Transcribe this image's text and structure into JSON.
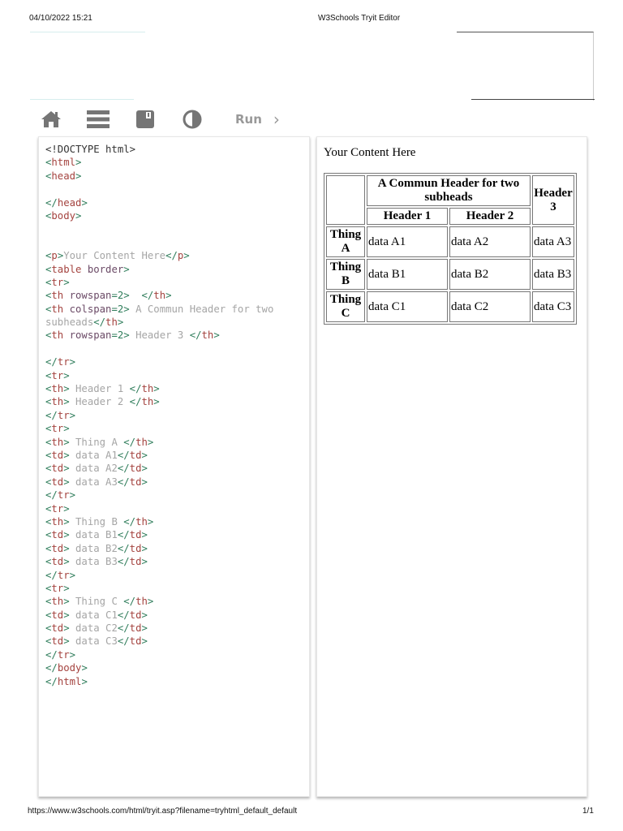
{
  "print_header": {
    "datetime": "04/10/2022 15:21",
    "title": "W3Schools Tryit Editor"
  },
  "toolbar": {
    "home_icon": "home-icon",
    "menu_icon": "menu-icon",
    "save_icon": "save-icon",
    "theme_icon": "contrast-icon",
    "run_label": "Run",
    "run_arrow": "›"
  },
  "colors": {
    "bracket": "#2f7d5b",
    "tag": "#a4433f",
    "attr": "#6b4a66",
    "text": "#a5a5a5"
  },
  "code_lines": [
    [
      [
        "d",
        "<!DOCTYPE html>"
      ]
    ],
    [
      [
        "b",
        "<"
      ],
      [
        "t",
        "html"
      ],
      [
        "b",
        ">"
      ]
    ],
    [
      [
        "b",
        "<"
      ],
      [
        "t",
        "head"
      ],
      [
        "b",
        ">"
      ]
    ],
    [],
    [
      [
        "b",
        "</"
      ],
      [
        "t",
        "head"
      ],
      [
        "b",
        ">"
      ]
    ],
    [
      [
        "b",
        "<"
      ],
      [
        "t",
        "body"
      ],
      [
        "b",
        ">"
      ]
    ],
    [],
    [],
    [
      [
        "b",
        "<"
      ],
      [
        "t",
        "p"
      ],
      [
        "b",
        ">"
      ],
      [
        "x",
        "Your Content Here"
      ],
      [
        "b",
        "</"
      ],
      [
        "t",
        "p"
      ],
      [
        "b",
        ">"
      ]
    ],
    [
      [
        "b",
        "<"
      ],
      [
        "t",
        "table"
      ],
      [
        "a",
        " border"
      ],
      [
        "b",
        ">"
      ]
    ],
    [
      [
        "b",
        "<"
      ],
      [
        "t",
        "tr"
      ],
      [
        "b",
        ">"
      ]
    ],
    [
      [
        "b",
        "<"
      ],
      [
        "t",
        "th"
      ],
      [
        "a",
        " rowspan"
      ],
      [
        "v",
        "=2"
      ],
      [
        "b",
        ">"
      ],
      [
        "x",
        "  "
      ],
      [
        "b",
        "</"
      ],
      [
        "t",
        "th"
      ],
      [
        "b",
        ">"
      ]
    ],
    [
      [
        "b",
        "<"
      ],
      [
        "t",
        "th"
      ],
      [
        "a",
        " colspan"
      ],
      [
        "v",
        "=2"
      ],
      [
        "b",
        ">"
      ],
      [
        "x",
        " A Commun Header for two"
      ]
    ],
    [
      [
        "x",
        "subheads"
      ],
      [
        "b",
        "</"
      ],
      [
        "t",
        "th"
      ],
      [
        "b",
        ">"
      ]
    ],
    [
      [
        "b",
        "<"
      ],
      [
        "t",
        "th"
      ],
      [
        "a",
        " rowspan"
      ],
      [
        "v",
        "=2"
      ],
      [
        "b",
        ">"
      ],
      [
        "x",
        " Header 3 "
      ],
      [
        "b",
        "</"
      ],
      [
        "t",
        "th"
      ],
      [
        "b",
        ">"
      ]
    ],
    [],
    [
      [
        "b",
        "</"
      ],
      [
        "t",
        "tr"
      ],
      [
        "b",
        ">"
      ]
    ],
    [
      [
        "b",
        "<"
      ],
      [
        "t",
        "tr"
      ],
      [
        "b",
        ">"
      ]
    ],
    [
      [
        "b",
        "<"
      ],
      [
        "t",
        "th"
      ],
      [
        "b",
        ">"
      ],
      [
        "x",
        " Header 1 "
      ],
      [
        "b",
        "</"
      ],
      [
        "t",
        "th"
      ],
      [
        "b",
        ">"
      ]
    ],
    [
      [
        "b",
        "<"
      ],
      [
        "t",
        "th"
      ],
      [
        "b",
        ">"
      ],
      [
        "x",
        " Header 2 "
      ],
      [
        "b",
        "</"
      ],
      [
        "t",
        "th"
      ],
      [
        "b",
        ">"
      ]
    ],
    [
      [
        "b",
        "</"
      ],
      [
        "t",
        "tr"
      ],
      [
        "b",
        ">"
      ]
    ],
    [
      [
        "b",
        "<"
      ],
      [
        "t",
        "tr"
      ],
      [
        "b",
        ">"
      ]
    ],
    [
      [
        "b",
        "<"
      ],
      [
        "t",
        "th"
      ],
      [
        "b",
        ">"
      ],
      [
        "x",
        " Thing A "
      ],
      [
        "b",
        "</"
      ],
      [
        "t",
        "th"
      ],
      [
        "b",
        ">"
      ]
    ],
    [
      [
        "b",
        "<"
      ],
      [
        "t",
        "td"
      ],
      [
        "b",
        ">"
      ],
      [
        "x",
        " data A1"
      ],
      [
        "b",
        "</"
      ],
      [
        "t",
        "td"
      ],
      [
        "b",
        ">"
      ]
    ],
    [
      [
        "b",
        "<"
      ],
      [
        "t",
        "td"
      ],
      [
        "b",
        ">"
      ],
      [
        "x",
        " data A2"
      ],
      [
        "b",
        "</"
      ],
      [
        "t",
        "td"
      ],
      [
        "b",
        ">"
      ]
    ],
    [
      [
        "b",
        "<"
      ],
      [
        "t",
        "td"
      ],
      [
        "b",
        ">"
      ],
      [
        "x",
        " data A3"
      ],
      [
        "b",
        "</"
      ],
      [
        "t",
        "td"
      ],
      [
        "b",
        ">"
      ]
    ],
    [
      [
        "b",
        "</"
      ],
      [
        "t",
        "tr"
      ],
      [
        "b",
        ">"
      ]
    ],
    [
      [
        "b",
        "<"
      ],
      [
        "t",
        "tr"
      ],
      [
        "b",
        ">"
      ]
    ],
    [
      [
        "b",
        "<"
      ],
      [
        "t",
        "th"
      ],
      [
        "b",
        ">"
      ],
      [
        "x",
        " Thing B "
      ],
      [
        "b",
        "</"
      ],
      [
        "t",
        "th"
      ],
      [
        "b",
        ">"
      ]
    ],
    [
      [
        "b",
        "<"
      ],
      [
        "t",
        "td"
      ],
      [
        "b",
        ">"
      ],
      [
        "x",
        " data B1"
      ],
      [
        "b",
        "</"
      ],
      [
        "t",
        "td"
      ],
      [
        "b",
        ">"
      ]
    ],
    [
      [
        "b",
        "<"
      ],
      [
        "t",
        "td"
      ],
      [
        "b",
        ">"
      ],
      [
        "x",
        " data B2"
      ],
      [
        "b",
        "</"
      ],
      [
        "t",
        "td"
      ],
      [
        "b",
        ">"
      ]
    ],
    [
      [
        "b",
        "<"
      ],
      [
        "t",
        "td"
      ],
      [
        "b",
        ">"
      ],
      [
        "x",
        " data B3"
      ],
      [
        "b",
        "</"
      ],
      [
        "t",
        "td"
      ],
      [
        "b",
        ">"
      ]
    ],
    [
      [
        "b",
        "</"
      ],
      [
        "t",
        "tr"
      ],
      [
        "b",
        ">"
      ]
    ],
    [
      [
        "b",
        "<"
      ],
      [
        "t",
        "tr"
      ],
      [
        "b",
        ">"
      ]
    ],
    [
      [
        "b",
        "<"
      ],
      [
        "t",
        "th"
      ],
      [
        "b",
        ">"
      ],
      [
        "x",
        " Thing C "
      ],
      [
        "b",
        "</"
      ],
      [
        "t",
        "th"
      ],
      [
        "b",
        ">"
      ]
    ],
    [
      [
        "b",
        "<"
      ],
      [
        "t",
        "td"
      ],
      [
        "b",
        ">"
      ],
      [
        "x",
        " data C1"
      ],
      [
        "b",
        "</"
      ],
      [
        "t",
        "td"
      ],
      [
        "b",
        ">"
      ]
    ],
    [
      [
        "b",
        "<"
      ],
      [
        "t",
        "td"
      ],
      [
        "b",
        ">"
      ],
      [
        "x",
        " data C2"
      ],
      [
        "b",
        "</"
      ],
      [
        "t",
        "td"
      ],
      [
        "b",
        ">"
      ]
    ],
    [
      [
        "b",
        "<"
      ],
      [
        "t",
        "td"
      ],
      [
        "b",
        ">"
      ],
      [
        "x",
        " data C3"
      ],
      [
        "b",
        "</"
      ],
      [
        "t",
        "td"
      ],
      [
        "b",
        ">"
      ]
    ],
    [
      [
        "b",
        "</"
      ],
      [
        "t",
        "tr"
      ],
      [
        "b",
        ">"
      ]
    ],
    [
      [
        "b",
        "</"
      ],
      [
        "t",
        "body"
      ],
      [
        "b",
        ">"
      ]
    ],
    [
      [
        "b",
        "</"
      ],
      [
        "t",
        "html"
      ],
      [
        "b",
        ">"
      ]
    ]
  ],
  "result": {
    "paragraph": "Your Content Here",
    "common_header": "A Commun Header for two subheads",
    "header3": "Header 3",
    "header1": "Header 1",
    "header2": "Header 2",
    "rows": [
      {
        "label": "Thing A",
        "cells": [
          "data A1",
          "data A2",
          "data A3"
        ]
      },
      {
        "label": "Thing B",
        "cells": [
          "data B1",
          "data B2",
          "data B3"
        ]
      },
      {
        "label": "Thing C",
        "cells": [
          "data C1",
          "data C2",
          "data C3"
        ]
      }
    ]
  },
  "print_footer": {
    "url": "https://www.w3schools.com/html/tryit.asp?filename=tryhtml_default_default",
    "page": "1/1"
  }
}
